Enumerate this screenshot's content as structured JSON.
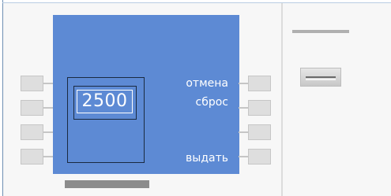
{
  "atm": {
    "amount_display": "2500",
    "side_buttons_right": {
      "cancel": "отмена",
      "reset": "сброс",
      "issue": "выдать"
    }
  },
  "colors": {
    "face": "#5d8ad4",
    "panel": "#f7f7f7",
    "keys": "#dedede",
    "card_slot": "#8c8c8c"
  },
  "icons": {
    "cash_dispenser": "cash-slot-icon",
    "receipt_slot": "receipt-slot-icon"
  }
}
